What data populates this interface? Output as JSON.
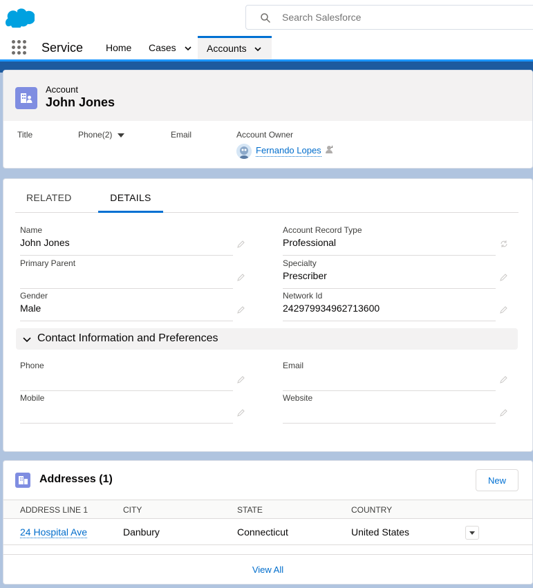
{
  "global_header": {
    "logo": "salesforce-cloud-logo",
    "search_placeholder": "Search Salesforce"
  },
  "nav": {
    "app_name": "Service",
    "items": [
      {
        "label": "Home"
      },
      {
        "label": "Cases"
      },
      {
        "label": "Accounts",
        "active": true
      }
    ]
  },
  "record": {
    "entity": "Account",
    "title": "John Jones",
    "highlights": {
      "title_label": "Title",
      "phone_label": "Phone(2)",
      "email_label": "Email",
      "owner_label": "Account Owner",
      "owner_name": "Fernando Lopes"
    }
  },
  "tabs": [
    {
      "label": "RELATED"
    },
    {
      "label": "DETAILS",
      "active": true
    }
  ],
  "details": {
    "name_label": "Name",
    "name_value": "John Jones",
    "record_type_label": "Account Record Type",
    "record_type_value": "Professional",
    "primary_parent_label": "Primary Parent",
    "primary_parent_value": "",
    "specialty_label": "Specialty",
    "specialty_value": "Prescriber",
    "gender_label": "Gender",
    "gender_value": "Male",
    "network_id_label": "Network Id",
    "network_id_value": "242979934962713600"
  },
  "contact_section": {
    "title": "Contact Information and Preferences",
    "phone_label": "Phone",
    "email_label": "Email",
    "mobile_label": "Mobile",
    "website_label": "Website"
  },
  "addresses": {
    "title": "Addresses (1)",
    "new_label": "New",
    "columns": [
      "ADDRESS LINE 1",
      "CITY",
      "STATE",
      "COUNTRY"
    ],
    "rows": [
      {
        "address": "24 Hospital Ave",
        "city": "Danbury",
        "state": "Connecticut",
        "country": "United States"
      }
    ],
    "view_all": "View All"
  },
  "colors": {
    "brand_blue": "#0070d2",
    "link_blue": "#006dcc",
    "account_icon": "#7f8de1"
  }
}
